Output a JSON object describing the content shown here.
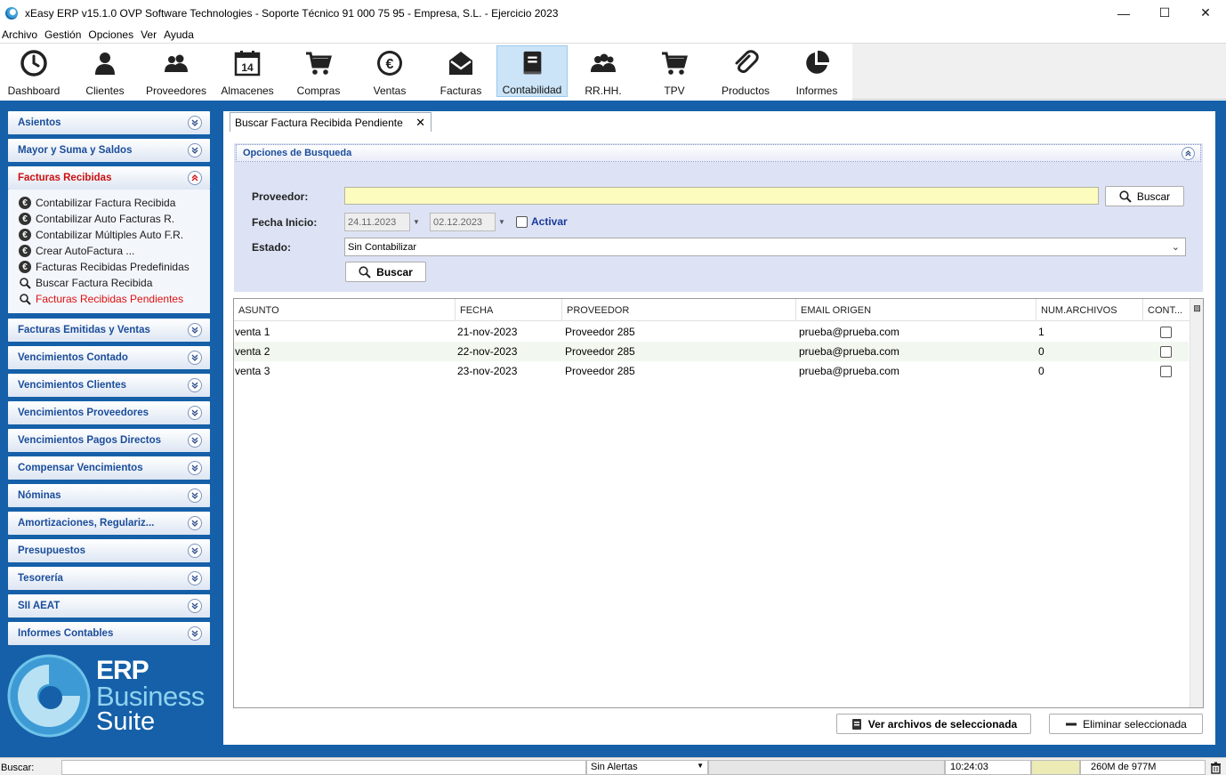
{
  "window": {
    "title": "xEasy ERP v15.1.0 OVP Software Technologies - Soporte Técnico 91 000 75 95 - Empresa, S.L. - Ejercicio 2023"
  },
  "menu": [
    "Archivo",
    "Gestión",
    "Opciones",
    "Ver",
    "Ayuda"
  ],
  "toolbar": {
    "items": [
      {
        "label": "Dashboard",
        "icon": "clock-icon"
      },
      {
        "label": "Clientes",
        "icon": "person-icon"
      },
      {
        "label": "Proveedores",
        "icon": "people-icon"
      },
      {
        "label": "Almacenes",
        "icon": "calendar-icon"
      },
      {
        "label": "Compras",
        "icon": "cart-icon"
      },
      {
        "label": "Ventas",
        "icon": "euro-icon"
      },
      {
        "label": "Facturas",
        "icon": "envelope-icon"
      },
      {
        "label": "Contabilidad",
        "icon": "ledger-icon",
        "active": true
      },
      {
        "label": "RR.HH.",
        "icon": "group-icon"
      },
      {
        "label": "TPV",
        "icon": "cart-icon"
      },
      {
        "label": "Productos",
        "icon": "paperclip-icon"
      },
      {
        "label": "Informes",
        "icon": "pie-chart-icon"
      }
    ],
    "calendar_day": "14"
  },
  "sidebar": {
    "sections": [
      {
        "label": "Asientos"
      },
      {
        "label": "Mayor y Suma y Saldos"
      },
      {
        "label": "Facturas Recibidas",
        "open": true
      },
      {
        "label": "Facturas Emitidas y Ventas"
      },
      {
        "label": "Vencimientos Contado"
      },
      {
        "label": "Vencimientos Clientes"
      },
      {
        "label": "Vencimientos Proveedores"
      },
      {
        "label": "Vencimientos Pagos Directos"
      },
      {
        "label": "Compensar Vencimientos"
      },
      {
        "label": "Nóminas"
      },
      {
        "label": "Amortizaciones, Regulariz..."
      },
      {
        "label": "Presupuestos"
      },
      {
        "label": "Tesorería"
      },
      {
        "label": "SII AEAT"
      },
      {
        "label": "Informes Contables"
      }
    ],
    "open_items": [
      {
        "label": "Contabilizar Factura Recibida",
        "icon": "euro-icon"
      },
      {
        "label": "Contabilizar Auto Facturas R.",
        "icon": "euro-icon"
      },
      {
        "label": "Contabilizar Múltiples Auto F.R.",
        "icon": "euro-icon"
      },
      {
        "label": "Crear AutoFactura ...",
        "icon": "euro-icon"
      },
      {
        "label": "Facturas Recibidas Predefinidas",
        "icon": "euro-icon"
      },
      {
        "label": "Buscar Factura Recibida",
        "icon": "search-icon"
      },
      {
        "label": "Facturas Recibidas Pendientes",
        "icon": "search-icon",
        "active": true
      }
    ]
  },
  "logo": {
    "line1": "ERP",
    "line2": "Business",
    "line3": "Suite"
  },
  "tab": {
    "label": "Buscar Factura Recibida Pendiente",
    "close": "✕"
  },
  "search": {
    "header": "Opciones de Busqueda",
    "proveedor_label": "Proveedor:",
    "proveedor_value": "",
    "buscar_top": "Buscar",
    "fecha_label": "Fecha Inicio:",
    "fecha_desde": "24.11.2023",
    "fecha_hasta": "02.12.2023",
    "activar_label": "Activar",
    "estado_label": "Estado:",
    "estado_value": "Sin Contabilizar",
    "buscar_bottom": "Buscar"
  },
  "grid": {
    "columns": [
      "ASUNTO",
      "FECHA",
      "PROVEEDOR",
      "EMAIL ORIGEN",
      "NUM.ARCHIVOS",
      "CONT..."
    ],
    "rows": [
      {
        "asunto": "venta 1",
        "fecha": "21-nov-2023",
        "proveedor": "Proveedor 285",
        "email": "prueba@prueba.com",
        "num": "1"
      },
      {
        "asunto": "venta 2",
        "fecha": "22-nov-2023",
        "proveedor": "Proveedor 285",
        "email": "prueba@prueba.com",
        "num": "0"
      },
      {
        "asunto": "venta 3",
        "fecha": "23-nov-2023",
        "proveedor": "Proveedor 285",
        "email": "prueba@prueba.com",
        "num": "0"
      }
    ]
  },
  "actions": {
    "ver_archivos": "Ver archivos de seleccionada",
    "eliminar": "Eliminar seleccionada"
  },
  "status": {
    "buscar_label": "Buscar:",
    "alertas": "Sin Alertas",
    "time": "10:24:03",
    "memory": "260M de 977M"
  },
  "colors": {
    "blue_bg": "#1560a8",
    "active_red": "#e01010",
    "accordion_text": "#1b4d9a"
  }
}
